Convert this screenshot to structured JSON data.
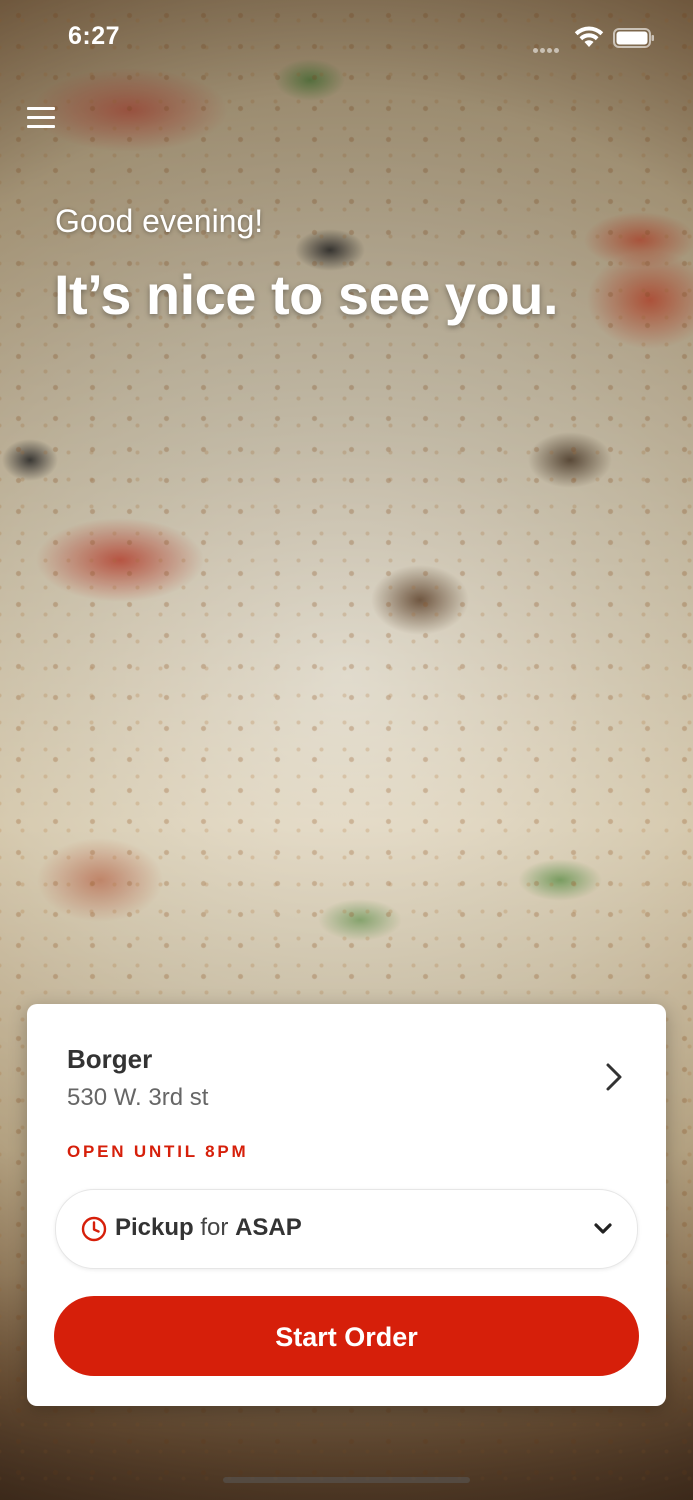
{
  "status_bar": {
    "time": "6:27"
  },
  "icons": {
    "menu": "hamburger-menu-icon",
    "wifi": "wifi-icon",
    "battery": "battery-icon",
    "chevron_right": "chevron-right-icon",
    "clock": "clock-icon",
    "chevron_down": "chevron-down-icon"
  },
  "hero": {
    "greeting": "Good evening!",
    "headline": "It’s nice to see you."
  },
  "store": {
    "name": "Borger",
    "address": "530 W. 3rd st",
    "hours": "OPEN UNTIL 8PM"
  },
  "order_mode": {
    "mode": "Pickup",
    "connector": "for",
    "time": "ASAP"
  },
  "actions": {
    "start_order": "Start Order"
  },
  "colors": {
    "accent": "#d61f0a",
    "card_background": "#ffffff",
    "text_primary": "#333333",
    "text_secondary": "#666666"
  }
}
